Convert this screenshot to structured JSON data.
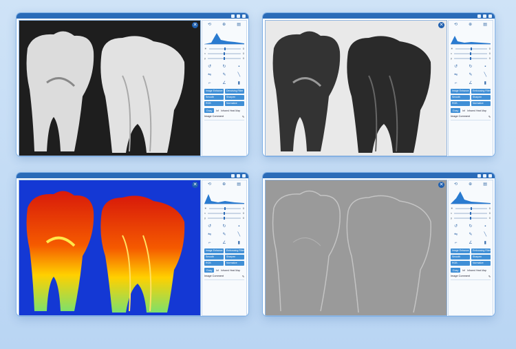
{
  "windows": [
    {
      "name": "original",
      "tools": [
        "⟲",
        "⊕",
        "▤"
      ],
      "buttons": [
        "Image Enhance",
        "Denoising Filter",
        "Smooth",
        "Sharpen",
        "RGB",
        "Normalize"
      ],
      "bottom": [
        "Gray",
        "Inf",
        "Infrared Heat Map"
      ],
      "comment_label": "Image Comment"
    },
    {
      "name": "inverted",
      "tools": [
        "⟲",
        "⊕",
        "▤"
      ],
      "buttons": [
        "Image Enhance",
        "Embossing Filter",
        "Smooth",
        "Sharpen",
        "RGB",
        "Normalize"
      ],
      "bottom": [
        "Gray",
        "Inf",
        "Infrared Heat Map"
      ],
      "comment_label": "Image Comment"
    },
    {
      "name": "heatmap",
      "tools": [
        "⟲",
        "⊕",
        "▤"
      ],
      "buttons": [
        "Image Enhance",
        "Embossing Filter",
        "Smooth",
        "Sharpen",
        "RGB",
        "Normalize"
      ],
      "bottom": [
        "Gray",
        "Inf",
        "Infrared Heat Map"
      ],
      "comment_label": "Image Comment"
    },
    {
      "name": "emboss",
      "tools": [
        "⟲",
        "⊕",
        "▤"
      ],
      "buttons": [
        "Image Enhance",
        "Embossing Filter",
        "Smooth",
        "Sharpen",
        "RGB",
        "Normalize"
      ],
      "bottom": [
        "Gray",
        "Inf",
        "Infrared Heat Map"
      ],
      "comment_label": "Image Comment"
    }
  ],
  "icons": {
    "close": "close-icon",
    "reset": "reset-icon",
    "zoom": "zoom-icon",
    "save": "save-icon"
  }
}
